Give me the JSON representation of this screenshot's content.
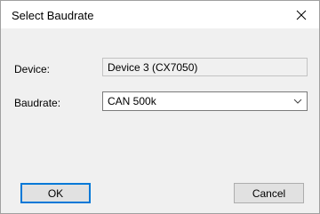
{
  "window": {
    "title": "Select Baudrate"
  },
  "form": {
    "device_label": "Device:",
    "device_value": "Device 3 (CX7050)",
    "baudrate_label": "Baudrate:",
    "baudrate_value": "CAN 500k"
  },
  "buttons": {
    "ok": "OK",
    "cancel": "Cancel"
  },
  "icons": {
    "close": "close-icon",
    "dropdown": "chevron-down-icon"
  }
}
